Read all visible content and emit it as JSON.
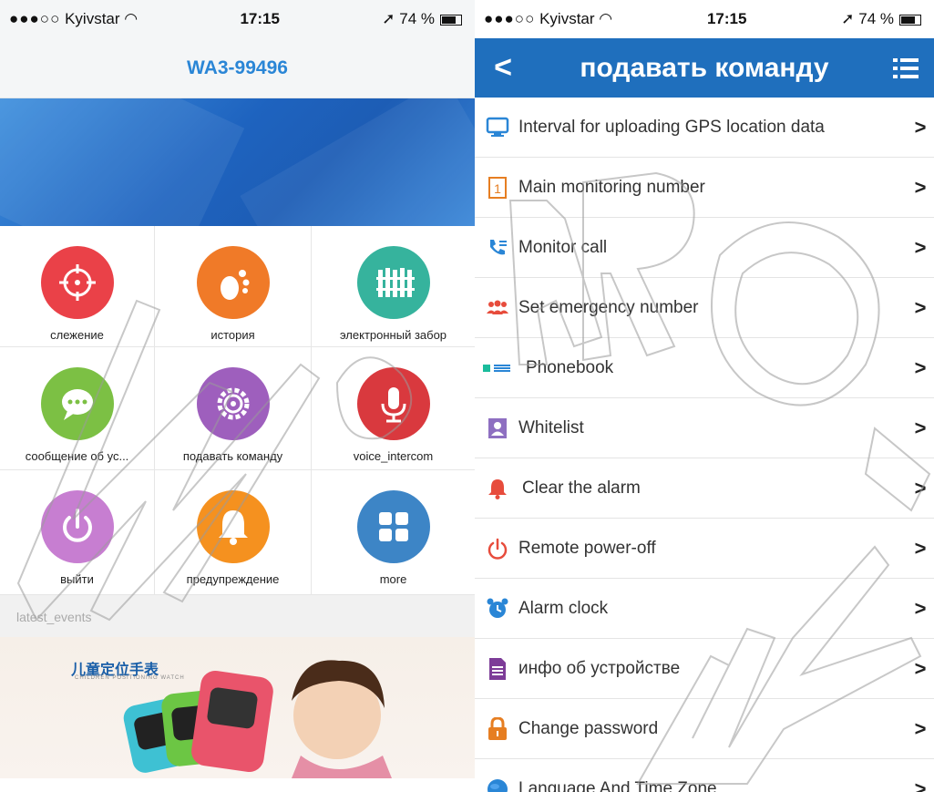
{
  "left_screen": {
    "status": {
      "carrier": "Kyivstar",
      "time": "17:15",
      "battery": "74 %"
    },
    "title": "WA3-99496",
    "tiles": [
      {
        "label": "слежение",
        "icon": "target-icon",
        "color": "#ea4148"
      },
      {
        "label": "история",
        "icon": "footprint-icon",
        "color": "#f07a28"
      },
      {
        "label": "электронный забор",
        "icon": "fence-icon",
        "color": "#36b39d"
      },
      {
        "label": "сообщение об ус...",
        "icon": "chat-icon",
        "color": "#7cc044"
      },
      {
        "label": "подавать команду",
        "icon": "gear-icon",
        "color": "#9e5fbd"
      },
      {
        "label": "voice_intercom",
        "icon": "microphone-icon",
        "color": "#d9393e"
      },
      {
        "label": "выйти",
        "icon": "power-icon",
        "color": "#c77ed1"
      },
      {
        "label": "предупреждение",
        "icon": "bell-icon",
        "color": "#f5911f"
      },
      {
        "label": "more",
        "icon": "grid-icon",
        "color": "#3d85c6"
      }
    ],
    "events_label": "latest_events",
    "promo_title": "儿童定位手表",
    "promo_subtitle": "CHILDREN POSITIONING WATCH"
  },
  "right_screen": {
    "status": {
      "carrier": "Kyivstar",
      "time": "17:15",
      "battery": "74 %"
    },
    "back_symbol": "<",
    "title": "подавать команду",
    "chevron": ">",
    "items": [
      {
        "label": "Interval for uploading GPS location data",
        "icon": "monitor-icon",
        "color": "#2a86d6"
      },
      {
        "label": "Main monitoring number",
        "icon": "number-one-icon",
        "color": "#e67e22"
      },
      {
        "label": "Monitor call",
        "icon": "phone-icon",
        "color": "#2a86d6"
      },
      {
        "label": "Set emergency number",
        "icon": "people-icon",
        "color": "#e74c3c"
      },
      {
        "label": "Phonebook",
        "icon": "phonebook-icon",
        "color": "#1abc9c"
      },
      {
        "label": "Whitelist",
        "icon": "contact-card-icon",
        "color": "#8e6fc1"
      },
      {
        "label": "Clear the alarm",
        "icon": "bell-icon",
        "color": "#e74c3c"
      },
      {
        "label": "Remote power-off",
        "icon": "power-icon",
        "color": "#e74c3c"
      },
      {
        "label": "Alarm clock",
        "icon": "alarm-clock-icon",
        "color": "#2a86d6"
      },
      {
        "label": "инфо об устройстве",
        "icon": "document-icon",
        "color": "#7d3c98"
      },
      {
        "label": "Change password",
        "icon": "padlock-icon",
        "color": "#e67e22"
      },
      {
        "label": "Language And Time Zone",
        "icon": "globe-icon",
        "color": "#2a86d6"
      }
    ]
  }
}
